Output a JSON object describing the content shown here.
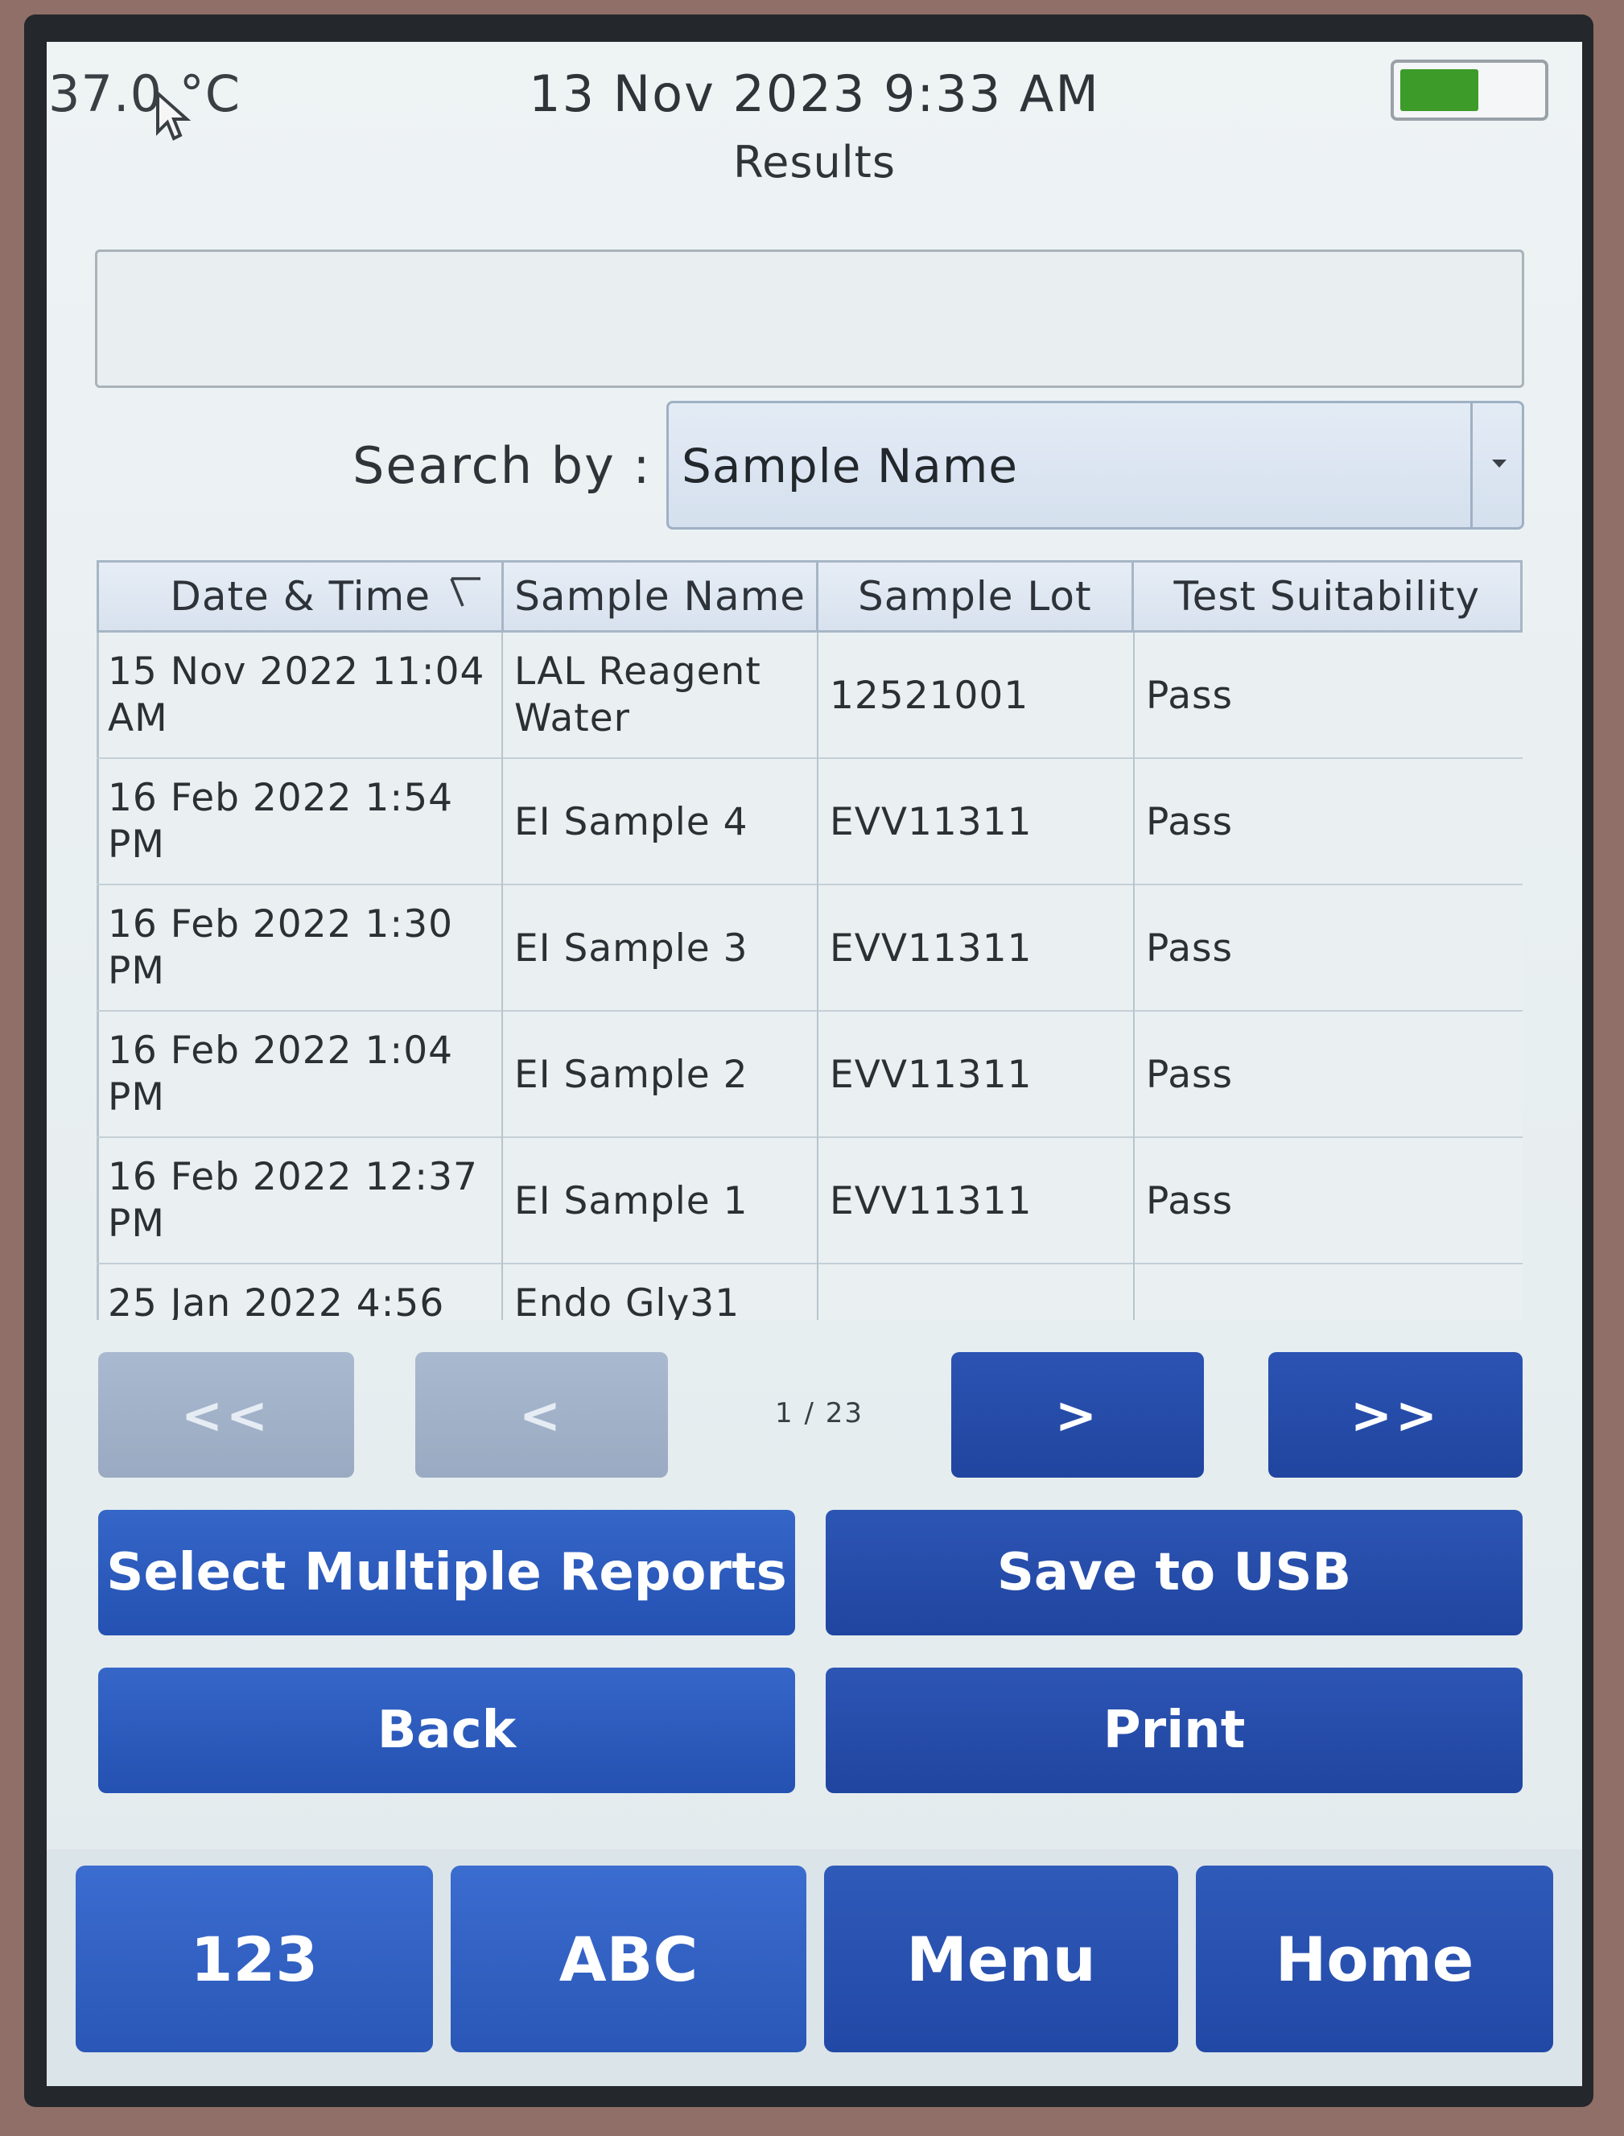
{
  "status": {
    "temperature": "37.0 °C",
    "datetime": "13 Nov 2023 9:33 AM",
    "battery_level": 0.55,
    "battery_color": "#3d9b2a"
  },
  "screen": {
    "title": "Results"
  },
  "search": {
    "input_value": "",
    "label": "Search by :",
    "selected_option": "Sample Name"
  },
  "table": {
    "columns": [
      "Date & Time",
      "Sample Name",
      "Sample Lot",
      "Test Suitability"
    ],
    "rows": [
      {
        "datetime": "15 Nov 2022 11:04 AM",
        "sample_name": "LAL Reagent Water",
        "sample_lot": "12521001",
        "suitability": "Pass"
      },
      {
        "datetime": "16 Feb 2022 1:54 PM",
        "sample_name": "EI Sample 4",
        "sample_lot": "EVV11311",
        "suitability": "Pass"
      },
      {
        "datetime": "16 Feb 2022 1:30 PM",
        "sample_name": "EI Sample 3",
        "sample_lot": "EVV11311",
        "suitability": "Pass"
      },
      {
        "datetime": "16 Feb 2022 1:04 PM",
        "sample_name": "EI Sample 2",
        "sample_lot": "EVV11311",
        "suitability": "Pass"
      },
      {
        "datetime": "16 Feb 2022 12:37 PM",
        "sample_name": "EI Sample 1",
        "sample_lot": "EVV11311",
        "suitability": "Pass"
      },
      {
        "datetime": "25 Jan 2022 4:56",
        "sample_name": "Endo Gly31",
        "sample_lot": "",
        "suitability": ""
      }
    ]
  },
  "pagination": {
    "first_label": "<<",
    "prev_label": "<",
    "page_indicator": "1 / 23",
    "next_label": ">",
    "last_label": ">>"
  },
  "actions": {
    "select_multiple": "Select Multiple Reports",
    "save_usb": "Save to USB",
    "back": "Back",
    "print": "Print"
  },
  "bottom_bar": {
    "num": "123",
    "abc": "ABC",
    "menu": "Menu",
    "home": "Home"
  },
  "colors": {
    "button_primary": "#2a57b7",
    "button_disabled": "#a9b9cf"
  }
}
